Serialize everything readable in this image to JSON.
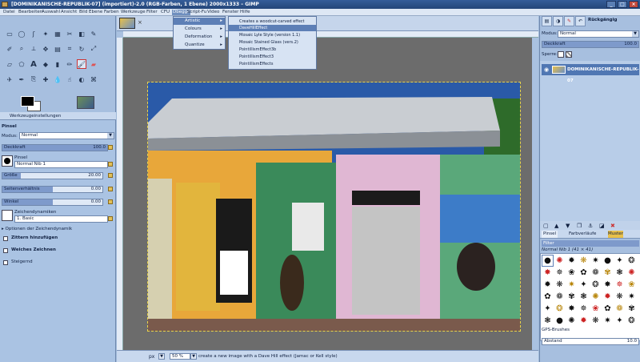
{
  "window": {
    "title": "[DOMINIKANISCHE-REPUBLIK-07] (importiert)-2.0 (RGB-Farben, 1 Ebene) 2000x1333 – GIMP",
    "min": "_",
    "max": "□",
    "close": "×"
  },
  "menubar": [
    "Datei",
    "Bearbeiten",
    "Auswahl",
    "Ansicht",
    "Bild",
    "Ebene",
    "Farben",
    "Werkzeuge",
    "Filter",
    "CFU",
    "Dbeggo",
    "Script-Fu",
    "Video",
    "Fenster",
    "Hilfe"
  ],
  "active_menu": "Dbeggo",
  "menu_level1": {
    "items": [
      "Artistic",
      "Colours",
      "Deformation",
      "Quantize"
    ],
    "active": "Artistic"
  },
  "menu_level2": {
    "items": [
      "Creates a woodcut-carved effect",
      "DaveHillEffect",
      "Mosaic Lyle Style (version 1.1)",
      "Mosaic Stained Glass (vers.2)",
      "PointillismEffect3b",
      "PointillismEffect3",
      "PointillismEffects"
    ],
    "active": "DaveHillEffect"
  },
  "tool_options": {
    "tab_label": "Werkzeugeinstellungen",
    "tool_name": "Pinsel",
    "mode_label": "Modus:",
    "mode_value": "Normal",
    "opacity_label": "Deckkraft",
    "opacity_value": "100.0",
    "opacity": 1.0,
    "brush_label": "Pinsel",
    "brush_value": "Normal Nib 1",
    "size_label": "Größe",
    "size_value": "20.00",
    "size_fill": 0.18,
    "aspect_label": "Seitenverhältnis",
    "aspect_value": "0.00",
    "aspect_fill": 0.5,
    "angle_label": "Winkel",
    "angle_value": "0.00",
    "angle_fill": 0.5,
    "dynamics_label": "Zeichendynamiken",
    "dynamics_value": "1. Basic",
    "dynamics_options": "Optionen der Zeichendynamik",
    "jitter": "Zittern hinzufügen",
    "smooth": "Weiches Zeichnen",
    "incremental": "Steigernd"
  },
  "image_tabs": [
    "photo-thumb-1"
  ],
  "statusbar": {
    "unit": "px",
    "zoom": "50 %",
    "message": "create a new image with a Dave Hill effect (Jamac or Kell style)"
  },
  "layers": {
    "undo_label": "Rückgängig",
    "mode_label": "Modus:",
    "mode_value": "Normal",
    "opacity_label": "Deckkraft",
    "opacity_value": "100.0",
    "lock_label": "Sperre:",
    "layer_name": "DOMINIKANISCHE-REPUBLIK-07"
  },
  "brush_panel": {
    "tabs": [
      "Pinsel",
      "Farbverläufe",
      "Muster"
    ],
    "filter_label": "Filter",
    "brush_name": "Normal Nib 1 (41 × 41)",
    "preset_name": "GPS-Brushes",
    "spacing_label": "Abstand",
    "spacing_value": "10.0"
  },
  "colors": {
    "fg": "#000000",
    "bg": "#ffffff",
    "accent": "#5d7fb6"
  }
}
